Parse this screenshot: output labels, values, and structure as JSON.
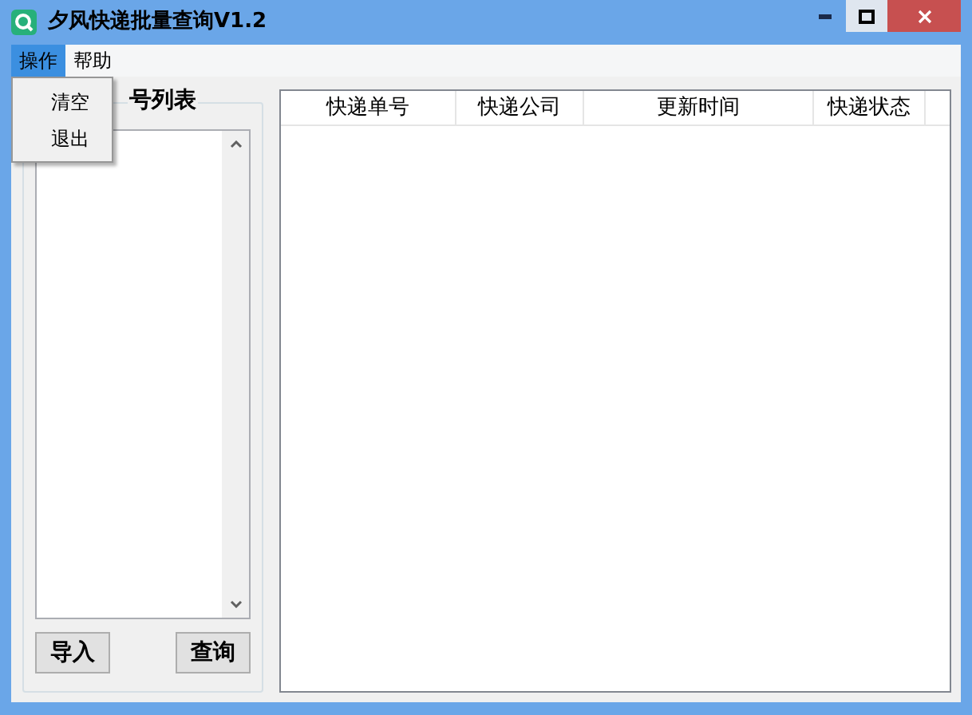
{
  "window": {
    "title": "夕风快递批量查询V1.2"
  },
  "menu_bar": [
    {
      "label": "操作",
      "selected": true
    },
    {
      "label": "帮助",
      "selected": false
    }
  ],
  "open_menu": {
    "items": [
      "清空",
      "退出"
    ]
  },
  "number_list": {
    "title": "号列表"
  },
  "buttons": [
    "导入",
    "查询"
  ],
  "table": {
    "columns": [
      "快递单号",
      "快递公司",
      "更新时间",
      "快递状态"
    ]
  }
}
